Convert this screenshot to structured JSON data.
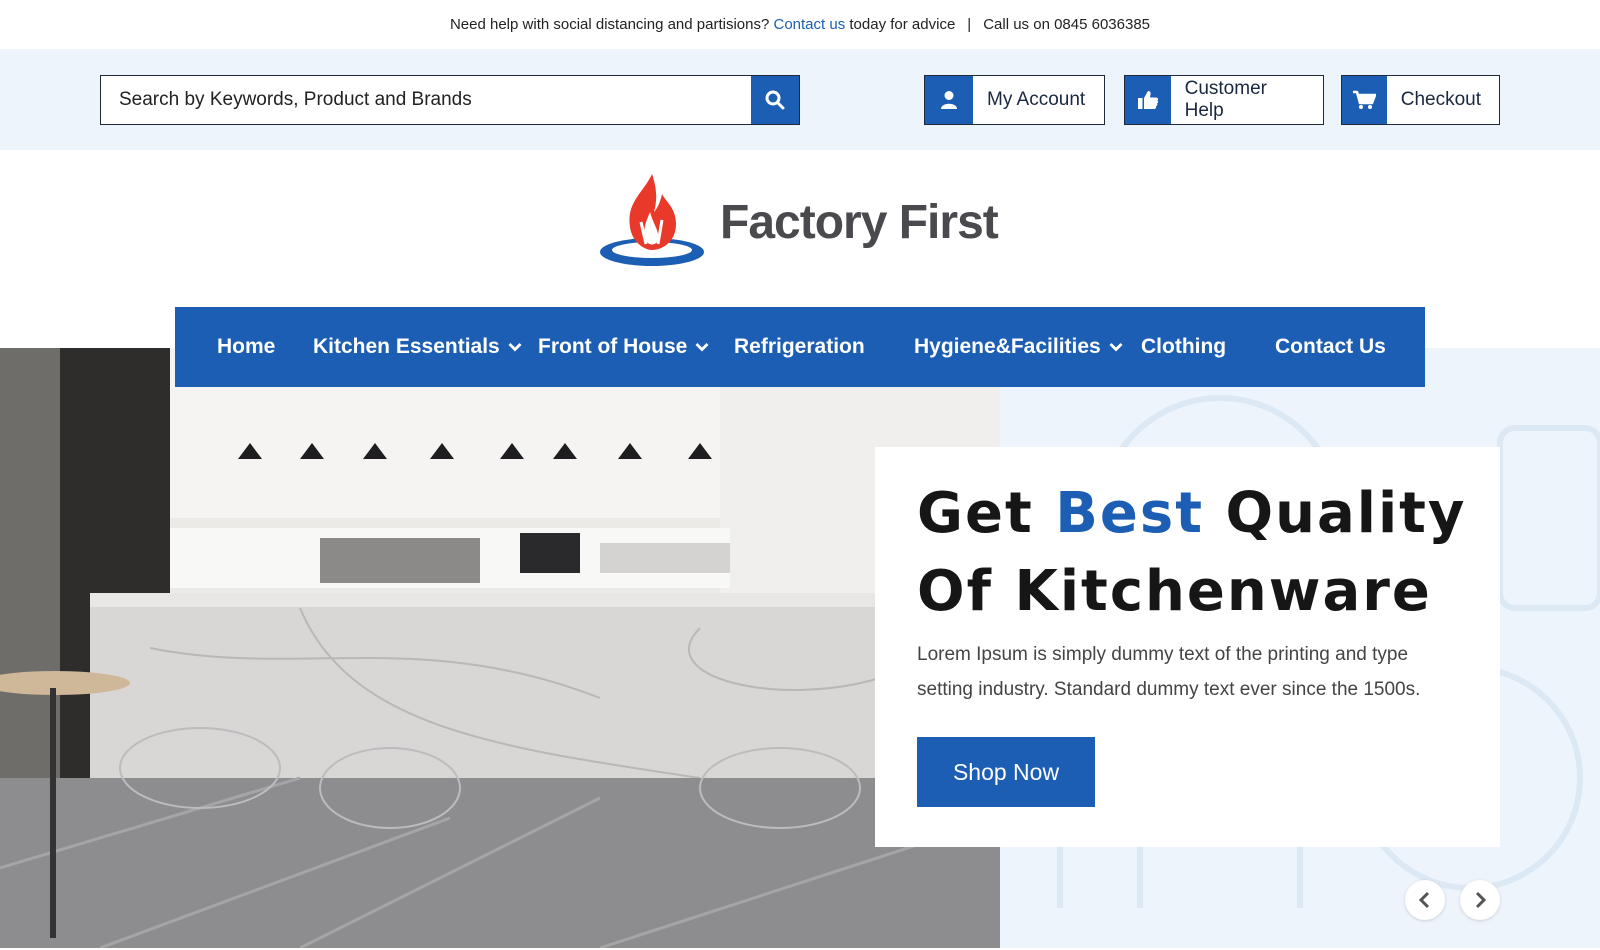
{
  "notice": {
    "prefix": "Need help with social distancing and  partisions?",
    "link": "Contact us",
    "suffix": "today for advice",
    "separator": "|",
    "call": "Call us on 0845 6036385"
  },
  "search": {
    "placeholder": "Search by Keywords, Product and Brands",
    "icon": "search-icon"
  },
  "account_links": [
    {
      "label": "My Account",
      "icon": "user-icon"
    },
    {
      "label": "Customer Help",
      "icon": "thumbs-up-icon"
    },
    {
      "label": "Checkout",
      "icon": "cart-icon"
    }
  ],
  "logo": {
    "text": "Factory First",
    "icon": "flame-logo-icon"
  },
  "nav": [
    {
      "label": "Home",
      "has_dropdown": false
    },
    {
      "label": "Kitchen Essentials",
      "has_dropdown": true
    },
    {
      "label": "Front of House",
      "has_dropdown": true
    },
    {
      "label": "Refrigeration",
      "has_dropdown": false
    },
    {
      "label": "Hygiene&Facilities",
      "has_dropdown": true
    },
    {
      "label": "Clothing",
      "has_dropdown": false
    },
    {
      "label": "Contact Us",
      "has_dropdown": false
    }
  ],
  "hero": {
    "title_start": "Get",
    "title_accent": "Best",
    "title_end": "Quality Of Kitchenware",
    "body": "Lorem Ipsum is simply dummy text of the printing and type setting industry. Standard dummy text ever since the 1500s.",
    "cta": "Shop Now",
    "prev_icon": "chevron-left-icon",
    "next_icon": "chevron-right-icon"
  },
  "colors": {
    "brand_blue": "#1b5eb3",
    "light_bg": "#eef4fb",
    "flame_red": "#e8392b"
  }
}
